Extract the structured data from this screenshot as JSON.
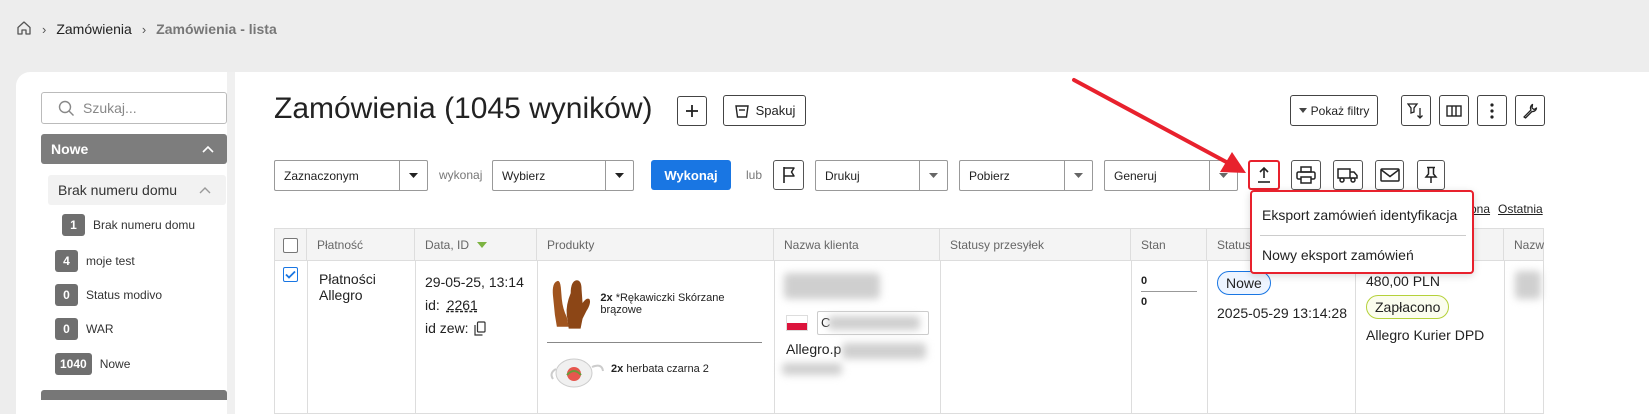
{
  "breadcrumb": {
    "home_icon": "home-icon",
    "items": [
      "Zamówienia",
      "Zamówienia - lista"
    ]
  },
  "sidebar": {
    "search_placeholder": "Szukaj...",
    "group_label": "Nowe",
    "subgroup_label": "Brak numeru domu",
    "items": [
      {
        "count": "1",
        "label": "Brak numeru domu"
      },
      {
        "count": "4",
        "label": "moje test"
      },
      {
        "count": "0",
        "label": "Status modivo"
      },
      {
        "count": "0",
        "label": "WAR"
      },
      {
        "count": "1040",
        "label": "Nowe"
      }
    ]
  },
  "header": {
    "title": "Zamówienia (1045 wyników)",
    "pack_label": "Spakuj",
    "filters_label": "Pokaż filtry"
  },
  "toolbar": {
    "selection_value": "Zaznaczonym",
    "execute_label": "wykonaj",
    "action_value": "Wybierz",
    "execute_button": "Wykonaj",
    "or_label": "lub",
    "print_value": "Drukuj",
    "download_value": "Pobierz",
    "generate_value": "Generuj"
  },
  "pagination": {
    "previous_partial": "ona",
    "last": "Ostatnia"
  },
  "table": {
    "headers": [
      "Płatność",
      "Data, ID",
      "Produkty",
      "Nazwa klienta",
      "Statusy przesyłek",
      "Stan",
      "Status",
      "",
      "Nazw"
    ],
    "row": {
      "payment": [
        "Płatności",
        "Allegro"
      ],
      "date": "29-05-25, 13:14",
      "id_label": "id:",
      "id_value": "2261",
      "ext_id_label": "id zew:",
      "products": [
        {
          "qty": "2x",
          "name": "*Rękawiczki Skórzane brązowe"
        },
        {
          "qty": "2x",
          "name": "herbata czarna 2"
        }
      ],
      "client_partial": "C",
      "client_email_partial": "Allegro.p",
      "stock": [
        "0",
        "0"
      ],
      "status_badge": "Nowe",
      "status_date": "2025-05-29 13:14:28",
      "amount": "480,00 PLN",
      "paid_badge": "Zapłacono",
      "shipping": "Allegro Kurier DPD"
    }
  },
  "export_menu": {
    "items": [
      "Eksport zamówień identyfikacja",
      "Nowy eksport zamówień"
    ]
  },
  "colors": {
    "primary": "#1976e3",
    "highlight": "#e8212d",
    "sidebar_group": "#7d7d7d"
  }
}
